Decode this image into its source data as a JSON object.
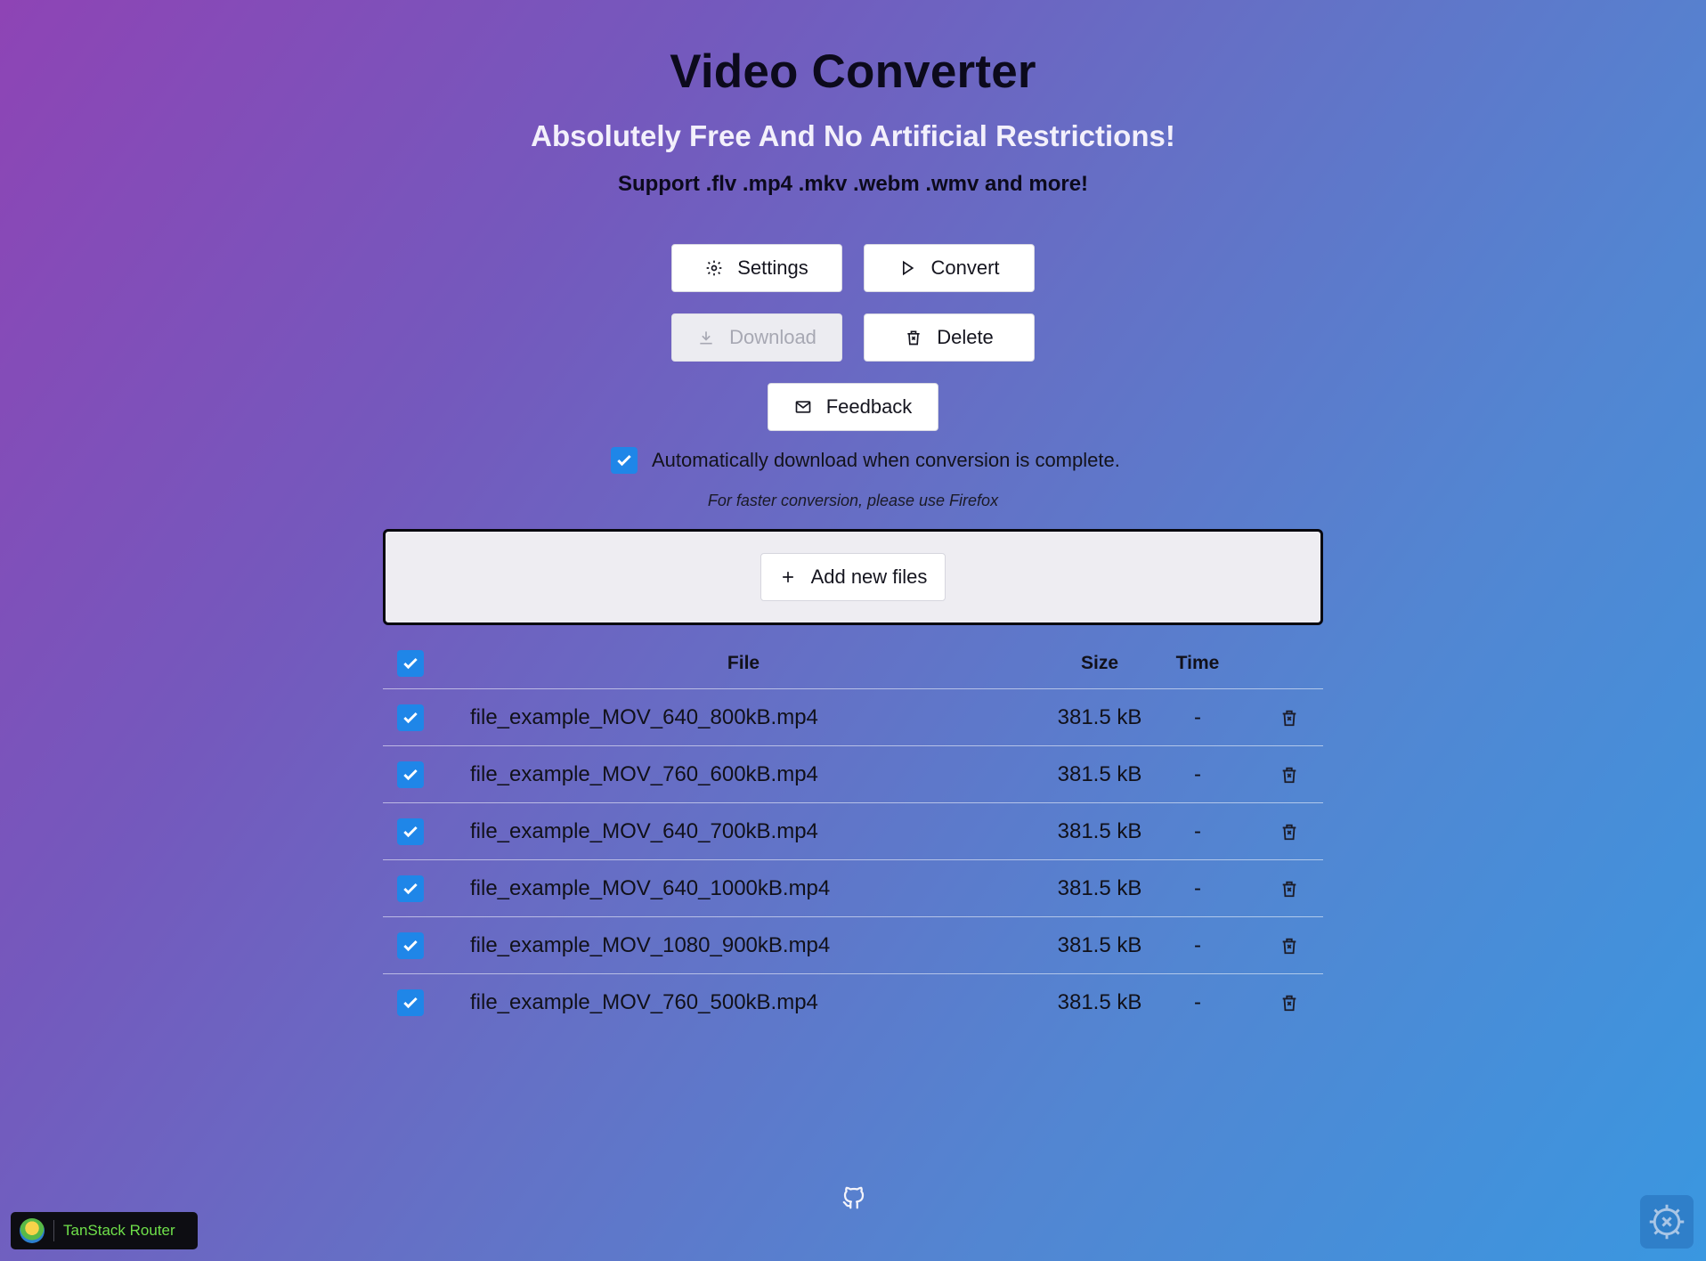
{
  "header": {
    "title": "Video Converter",
    "subtitle": "Absolutely Free And No Artificial Restrictions!",
    "support": "Support .flv .mp4 .mkv .webm .wmv and more!"
  },
  "toolbar": {
    "settings_label": "Settings",
    "convert_label": "Convert",
    "download_label": "Download",
    "delete_label": "Delete",
    "feedback_label": "Feedback"
  },
  "options": {
    "auto_download_label": "Automatically download when conversion is complete.",
    "auto_download_checked": true,
    "hint": "For faster conversion, please use Firefox"
  },
  "dropzone": {
    "add_label": "Add new files"
  },
  "table": {
    "headers": {
      "file": "File",
      "size": "Size",
      "time": "Time"
    },
    "rows": [
      {
        "file": "file_example_MOV_640_800kB.mp4",
        "size": "381.5 kB",
        "time": "-"
      },
      {
        "file": "file_example_MOV_760_600kB.mp4",
        "size": "381.5 kB",
        "time": "-"
      },
      {
        "file": "file_example_MOV_640_700kB.mp4",
        "size": "381.5 kB",
        "time": "-"
      },
      {
        "file": "file_example_MOV_640_1000kB.mp4",
        "size": "381.5 kB",
        "time": "-"
      },
      {
        "file": "file_example_MOV_1080_900kB.mp4",
        "size": "381.5 kB",
        "time": "-"
      },
      {
        "file": "file_example_MOV_760_500kB.mp4",
        "size": "381.5 kB",
        "time": "-"
      }
    ]
  },
  "footer": {
    "devtools_label": "TanStack Router"
  },
  "icons": {
    "settings": "gear-icon",
    "convert": "play-icon",
    "download": "download-icon",
    "delete": "trash-icon",
    "feedback": "mail-icon",
    "add": "plus-icon",
    "github": "github-icon",
    "devtools": "tanstack-logo-icon",
    "fab": "gear-icon"
  },
  "colors": {
    "checkbox": "#1f86e8",
    "devtools_text": "#6fe04a"
  }
}
